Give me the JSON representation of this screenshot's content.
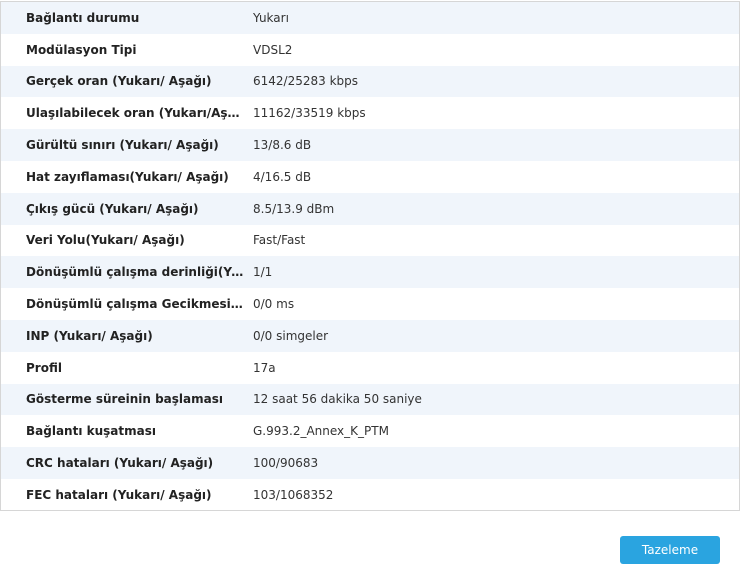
{
  "status_table": {
    "rows": [
      {
        "label": "Bağlantı durumu",
        "value": "Yukarı"
      },
      {
        "label": "Modülasyon Tipi",
        "value": "VDSL2"
      },
      {
        "label": "Gerçek oran (Yukarı/ Aşağı)",
        "value": "6142/25283 kbps"
      },
      {
        "label": "Ulaşılabilecek oran (Yukarı/Aşağı)",
        "value": "11162/33519 kbps"
      },
      {
        "label": "Gürültü sınırı (Yukarı/ Aşağı)",
        "value": "13/8.6 dB"
      },
      {
        "label": "Hat zayıflaması(Yukarı/ Aşağı)",
        "value": "4/16.5 dB"
      },
      {
        "label": "Çıkış gücü (Yukarı/ Aşağı)",
        "value": "8.5/13.9 dBm"
      },
      {
        "label": "Veri Yolu(Yukarı/ Aşağı)",
        "value": "Fast/Fast"
      },
      {
        "label": "Dönüşümlü çalışma derinliği(Yuka...",
        "value": "1/1"
      },
      {
        "label": "Dönüşümlü çalışma Gecikmesi(Yu...",
        "value": "0/0 ms"
      },
      {
        "label": "INP (Yukarı/ Aşağı)",
        "value": "0/0 simgeler"
      },
      {
        "label": "Profil",
        "value": "17a"
      },
      {
        "label": "Gösterme süreinin başlaması",
        "value": "12 saat 56 dakika 50 saniye"
      },
      {
        "label": "Bağlantı kuşatması",
        "value": "G.993.2_Annex_K_PTM"
      },
      {
        "label": "CRC hataları (Yukarı/ Aşağı)",
        "value": "100/90683"
      },
      {
        "label": "FEC hataları (Yukarı/ Aşağı)",
        "value": "103/1068352"
      }
    ]
  },
  "refresh_button": {
    "label": "Tazeleme"
  },
  "colors": {
    "accent": "#2aa4e0",
    "row_shade": "#f0f5fb"
  }
}
